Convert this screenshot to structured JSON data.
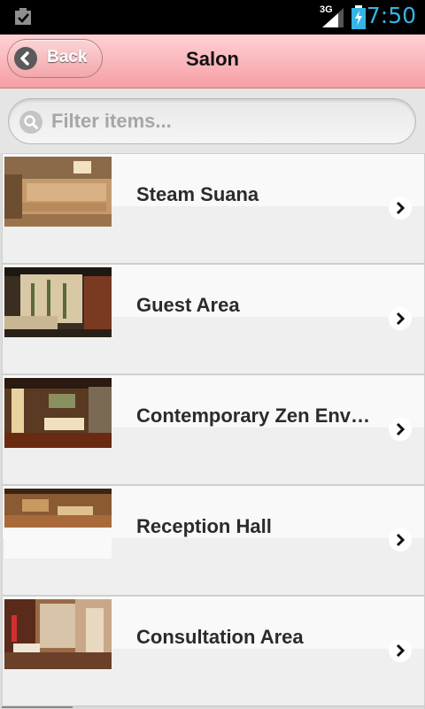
{
  "status_bar": {
    "network": "3G",
    "time": "7:50",
    "icons": [
      "notification-check-icon",
      "signal-icon",
      "battery-charging-icon"
    ],
    "accent_color": "#33b5e5"
  },
  "header": {
    "back_label": "Back",
    "title": "Salon",
    "background_color": "#f59ea4"
  },
  "search": {
    "placeholder": "Filter items..."
  },
  "list": {
    "items": [
      {
        "label": "Steam Suana",
        "icon": "chevron-right-icon"
      },
      {
        "label": "Guest Area",
        "icon": "chevron-right-icon"
      },
      {
        "label": "Contemporary Zen Environment",
        "icon": "chevron-right-icon"
      },
      {
        "label": "Reception Hall",
        "icon": "chevron-right-icon"
      },
      {
        "label": "Consultation Area",
        "icon": "chevron-right-icon"
      }
    ]
  }
}
